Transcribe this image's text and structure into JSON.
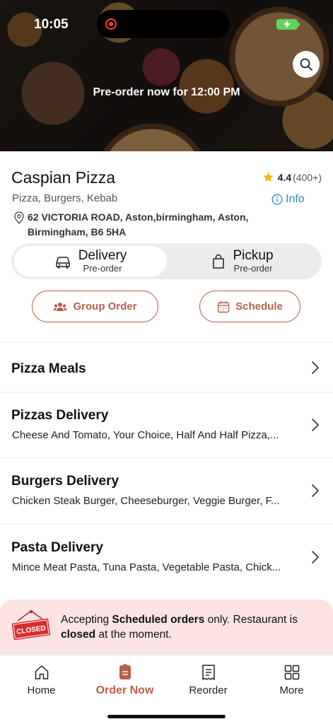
{
  "status_bar": {
    "time": "10:05"
  },
  "hero": {
    "preorder_text": "Pre-order now for 12:00 PM"
  },
  "restaurant": {
    "name": "Caspian Pizza",
    "rating": "4.4",
    "rating_count": "(400+)",
    "cuisines": "Pizza, Burgers, Kebab",
    "info_label": "Info",
    "address": "62 VICTORIA ROAD, Aston,birmingham, Aston, Birmingham, B6 5HA"
  },
  "order_mode": {
    "delivery": {
      "label": "Delivery",
      "sub": "Pre-order"
    },
    "pickup": {
      "label": "Pickup",
      "sub": "Pre-order"
    }
  },
  "actions": {
    "group_order": "Group Order",
    "schedule": "Schedule"
  },
  "categories": [
    {
      "title": "Pizza Meals",
      "desc": ""
    },
    {
      "title": "Pizzas Delivery",
      "desc": "Cheese And Tomato, Your Choice, Half And Half Pizza,..."
    },
    {
      "title": "Burgers Delivery",
      "desc": "Chicken Steak Burger, Cheeseburger, Veggie Burger, F..."
    },
    {
      "title": "Pasta Delivery",
      "desc": "Mince Meat Pasta, Tuna Pasta, Vegetable Pasta, Chick..."
    }
  ],
  "closed_banner": {
    "sign_text": "CLOSED",
    "msg_1": "Accepting ",
    "msg_2": "Scheduled orders",
    "msg_3": " only. Restaurant is ",
    "msg_4": "closed",
    "msg_5": " at the moment."
  },
  "nav": {
    "home": "Home",
    "order_now": "Order Now",
    "reorder": "Reorder",
    "more": "More"
  },
  "colors": {
    "accent": "#b5604a",
    "info_blue": "#2e8bc0",
    "banner_bg": "#fde4e4",
    "star": "#f5b400",
    "closed_red": "#d32f2f"
  },
  "icons": {
    "search": "search-icon",
    "star": "star-icon",
    "info": "info-icon",
    "pin": "location-pin-icon",
    "car": "car-icon",
    "bag": "shopping-bag-icon",
    "group": "group-icon",
    "calendar": "calendar-icon",
    "chevron": "chevron-right-icon",
    "home": "home-icon",
    "order": "order-icon",
    "receipt": "receipt-icon",
    "grid": "grid-icon"
  }
}
